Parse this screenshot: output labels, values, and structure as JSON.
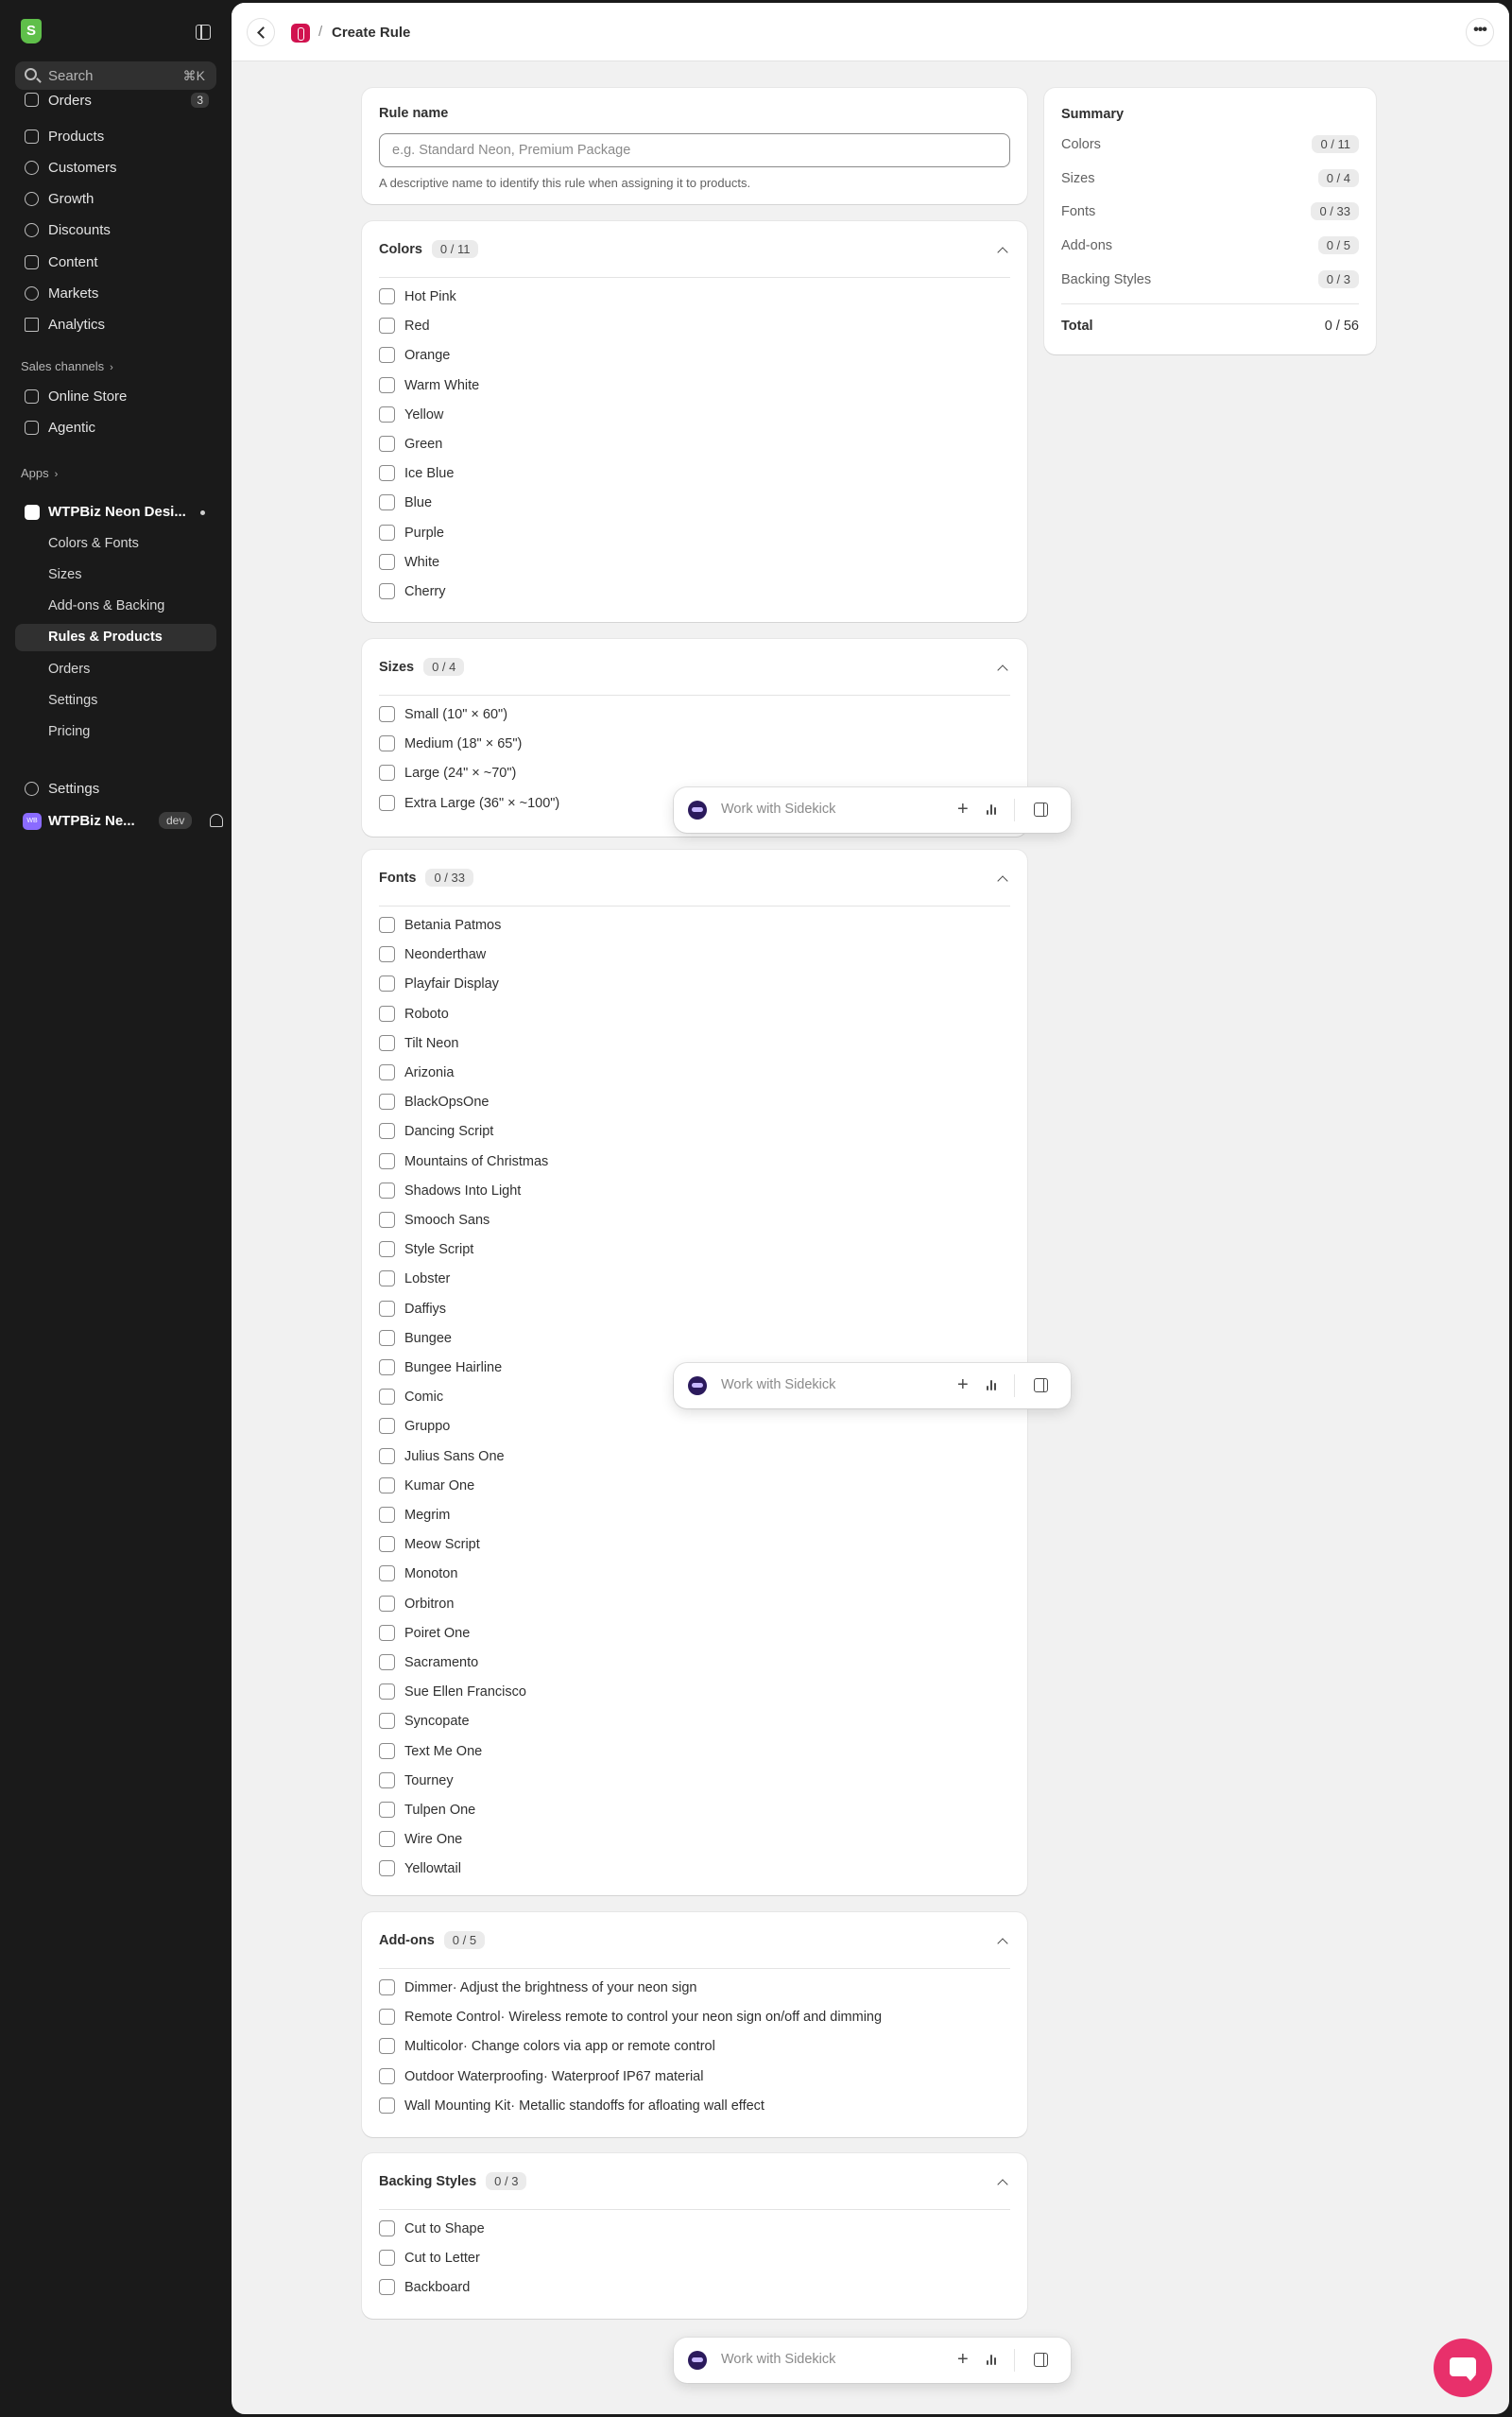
{
  "sidebar": {
    "search_placeholder": "Search",
    "search_shortcut": "⌘K",
    "items": [
      {
        "label": "Orders",
        "badge": "3"
      },
      {
        "label": "Products"
      },
      {
        "label": "Customers"
      },
      {
        "label": "Growth"
      },
      {
        "label": "Discounts"
      },
      {
        "label": "Content"
      },
      {
        "label": "Markets"
      },
      {
        "label": "Analytics"
      }
    ],
    "sales_channels_label": "Sales channels",
    "channels": [
      "Online Store",
      "Agentic"
    ],
    "apps_label": "Apps",
    "app_name": "WTPBiz Neon Desi...",
    "app_subitems": [
      "Colors & Fonts",
      "Sizes",
      "Add-ons & Backing",
      "Rules & Products",
      "Orders",
      "Settings",
      "Pricing"
    ],
    "active_subitem": "Rules & Products",
    "settings_label": "Settings",
    "store_name": "WTPBiz Ne...",
    "store_badge": "dev",
    "store_avatar_text": "WB"
  },
  "topbar": {
    "separator": "/",
    "title": "Create Rule",
    "more": "•••"
  },
  "rule_name": {
    "label": "Rule name",
    "placeholder": "e.g. Standard Neon, Premium Package",
    "value": "",
    "help": "A descriptive name to identify this rule when assigning it to products."
  },
  "colors": {
    "title": "Colors",
    "count": "0 / 11",
    "items": [
      "Hot Pink",
      "Red",
      "Orange",
      "Warm White",
      "Yellow",
      "Green",
      "Ice Blue",
      "Blue",
      "Purple",
      "White",
      "Cherry"
    ]
  },
  "sizes": {
    "title": "Sizes",
    "count": "0 / 4",
    "items": [
      "Small (10\" × 60\")",
      "Medium (18\" × 65\")",
      "Large (24\" × ~70\")",
      "Extra Large (36\" × ~100\")"
    ]
  },
  "fonts": {
    "title": "Fonts",
    "count": "0 / 33",
    "items": [
      "Betania Patmos",
      "Neonderthaw",
      "Playfair Display",
      "Roboto",
      "Tilt Neon",
      "Arizonia",
      "BlackOpsOne",
      "Dancing Script",
      "Mountains of Christmas",
      "Shadows Into Light",
      "Smooch Sans",
      "Style Script",
      "Lobster",
      "Daffiys",
      "Bungee",
      "Bungee Hairline",
      "Comic",
      "Gruppo",
      "Julius Sans One",
      "Kumar One",
      "Megrim",
      "Meow Script",
      "Monoton",
      "Orbitron",
      "Poiret One",
      "Sacramento",
      "Sue Ellen Francisco",
      "Syncopate",
      "Text Me One",
      "Tourney",
      "Tulpen One",
      "Wire One",
      "Yellowtail"
    ]
  },
  "addons": {
    "title": "Add-ons",
    "count": "0 / 5",
    "items": [
      "Dimmer· Adjust the brightness of your neon sign",
      "Remote Control· Wireless remote to control your neon sign on/off and dimming",
      "Multicolor· Change colors via app or remote control",
      "Outdoor Waterproofing· Waterproof IP67 material",
      "Wall Mounting Kit· Metallic standoffs for afloating wall effect"
    ]
  },
  "backing": {
    "title": "Backing Styles",
    "count": "0 / 3",
    "items": [
      "Cut to Shape",
      "Cut to Letter",
      "Backboard"
    ]
  },
  "summary": {
    "title": "Summary",
    "rows": [
      {
        "label": "Colors",
        "value": "0 / 11"
      },
      {
        "label": "Sizes",
        "value": "0 / 4"
      },
      {
        "label": "Fonts",
        "value": "0 / 33"
      },
      {
        "label": "Add-ons",
        "value": "0 / 5"
      },
      {
        "label": "Backing Styles",
        "value": "0 / 3"
      }
    ],
    "total_label": "Total",
    "total_value": "0 / 56"
  },
  "sidekick": {
    "placeholder": "Work with Sidekick",
    "plus": "+"
  }
}
